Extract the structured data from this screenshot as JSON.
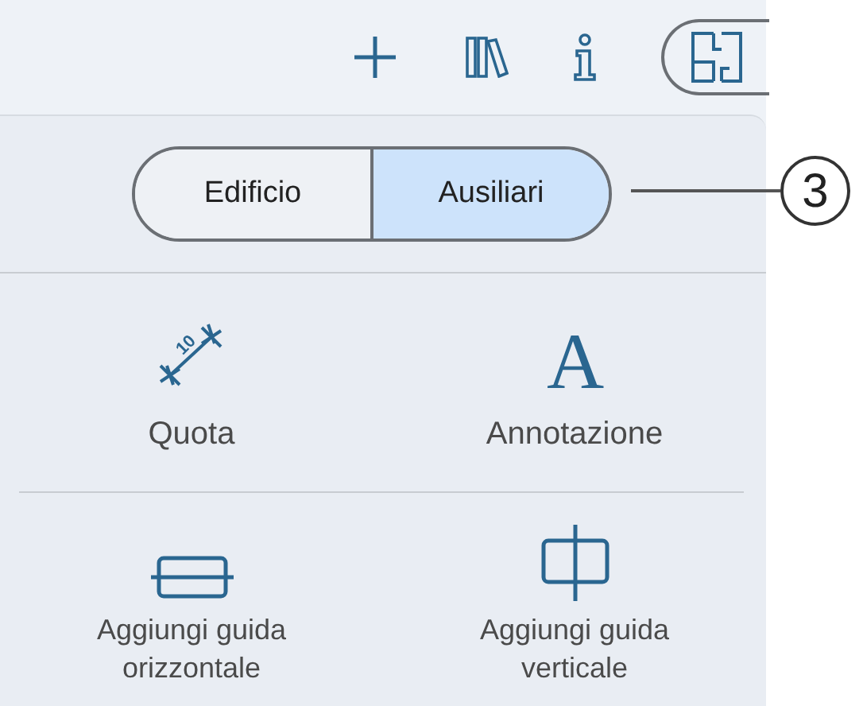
{
  "segmented": [
    {
      "label": "Edificio",
      "selected": false
    },
    {
      "label": "Ausiliari",
      "selected": true
    }
  ],
  "callout": "3",
  "tools": [
    {
      "kind": "dimension",
      "label": "Quota",
      "icon_text": "10"
    },
    {
      "kind": "annotation",
      "label": "Annotazione",
      "icon_text": "A"
    },
    {
      "kind": "hguide",
      "label": "Aggiungi guida orizzontale"
    },
    {
      "kind": "vguide",
      "label": "Aggiungi guida verticale"
    }
  ]
}
